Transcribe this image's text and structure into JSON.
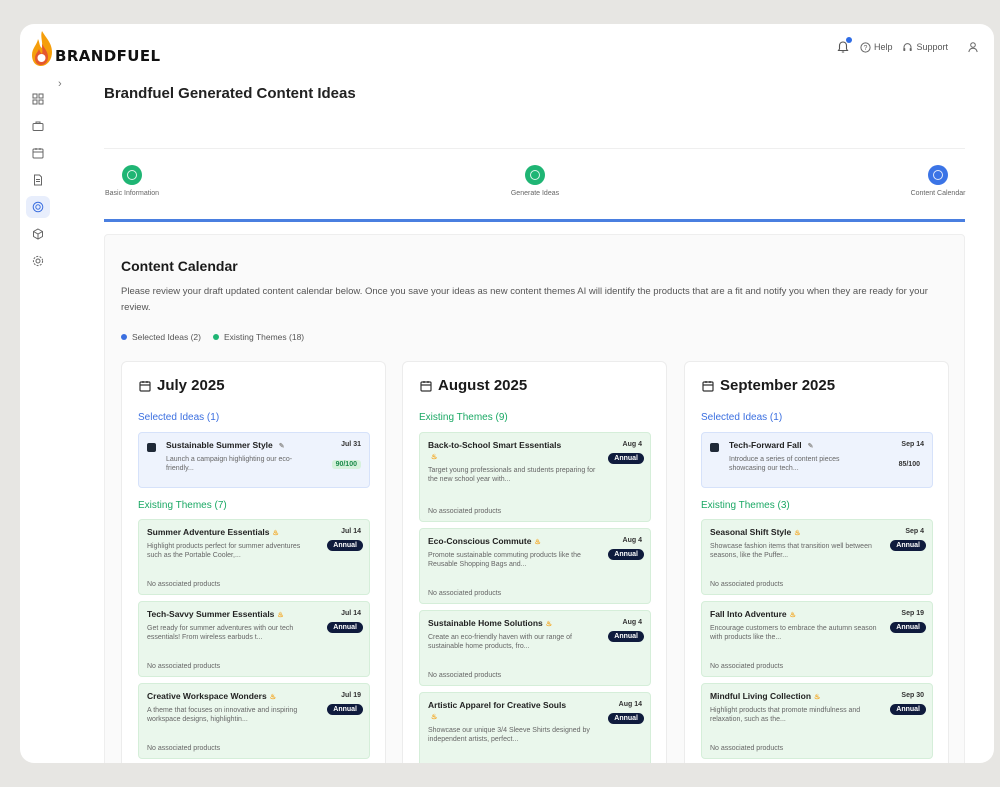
{
  "header": {
    "brand": "BRANDFUEL",
    "help": "Help",
    "support": "Support"
  },
  "page": {
    "title": "Brandfuel Generated Content Ideas"
  },
  "steps": [
    {
      "label": "Basic Information",
      "state": "done"
    },
    {
      "label": "Generate Ideas",
      "state": "done"
    },
    {
      "label": "Content Calendar",
      "state": "active"
    }
  ],
  "calendar": {
    "title": "Content Calendar",
    "description": "Please review your draft updated content calendar below. Once you save your ideas as new content themes AI will identify the products that are a fit and notify you when they are ready for your review.",
    "legend": {
      "selected": "Selected Ideas (2)",
      "existing": "Existing Themes (18)"
    },
    "colors": {
      "selected": "#3b6fe0",
      "existing": "#1fb574",
      "badge": "#0f1b3d"
    }
  },
  "months": [
    {
      "name": "July 2025",
      "selected_header": "Selected Ideas (1)",
      "selected": [
        {
          "title": "Sustainable Summer Style",
          "desc": "Launch a campaign highlighting our eco-friendly...",
          "date": "Jul 31",
          "score": "90/100"
        }
      ],
      "themes_header": "Existing Themes (7)",
      "themes": [
        {
          "title": "Summer Adventure Essentials",
          "desc": "Highlight products perfect for summer adventures such as the Portable Cooler,...",
          "date": "Jul 14",
          "badge": "Annual",
          "footer": "No associated products"
        },
        {
          "title": "Tech-Savvy Summer Essentials",
          "desc": "Get ready for summer adventures with our tech essentials! From wireless earbuds t...",
          "date": "Jul 14",
          "badge": "Annual",
          "footer": "No associated products"
        },
        {
          "title": "Creative Workspace Wonders",
          "desc": "A theme that focuses on innovative and inspiring workspace designs, highlightin...",
          "date": "Jul 19",
          "badge": "Annual",
          "footer": "No associated products"
        }
      ]
    },
    {
      "name": "August 2025",
      "themes_header": "Existing Themes (9)",
      "themes": [
        {
          "title": "Back-to-School Smart Essentials",
          "desc": "Target young professionals and students preparing for the new school year with...",
          "date": "Aug 4",
          "badge": "Annual",
          "footer": "No associated products"
        },
        {
          "title": "Eco-Conscious Commute",
          "desc": "Promote sustainable commuting products like the Reusable Shopping Bags and...",
          "date": "Aug 4",
          "badge": "Annual",
          "footer": "No associated products"
        },
        {
          "title": "Sustainable Home Solutions",
          "desc": "Create an eco-friendly haven with our range of sustainable home products, fro...",
          "date": "Aug 4",
          "badge": "Annual",
          "footer": "No associated products"
        },
        {
          "title": "Artistic Apparel for Creative Souls",
          "desc": "Showcase our unique 3/4 Sleeve Shirts designed by independent artists, perfect...",
          "date": "Aug 14",
          "badge": "Annual",
          "footer": ""
        }
      ]
    },
    {
      "name": "September 2025",
      "selected_header": "Selected Ideas (1)",
      "selected": [
        {
          "title": "Tech-Forward Fall",
          "desc": "Introduce a series of content pieces showcasing our tech...",
          "date": "Sep 14",
          "score": "85/100"
        }
      ],
      "themes_header": "Existing Themes (3)",
      "themes": [
        {
          "title": "Seasonal Shift Style",
          "desc": "Showcase fashion items that transition well between seasons, like the Puffer...",
          "date": "Sep 4",
          "badge": "Annual",
          "footer": "No associated products"
        },
        {
          "title": "Fall Into Adventure",
          "desc": "Encourage customers to embrace the autumn season with products like the...",
          "date": "Sep 19",
          "badge": "Annual",
          "footer": "No associated products"
        },
        {
          "title": "Mindful Living Collection",
          "desc": "Highlight products that promote mindfulness and relaxation, such as the...",
          "date": "Sep 30",
          "badge": "Annual",
          "footer": "No associated products"
        }
      ]
    }
  ]
}
